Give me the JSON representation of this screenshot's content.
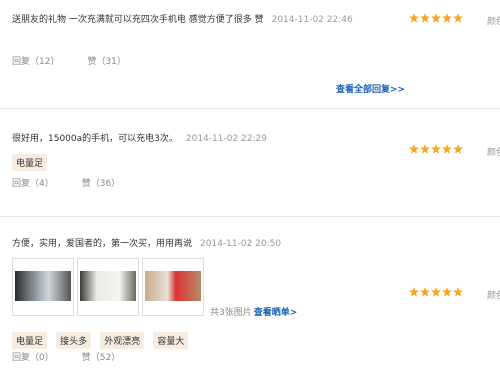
{
  "reviews": [
    {
      "text": "送朋友的礼物 一次充满就可以充四次手机电 感觉方便了很多 赞",
      "time": "2014-11-02 22:46",
      "rating": 5,
      "side": "颜色",
      "reply_label": "回复（12）",
      "like_label": "赞（31）",
      "view_all_replies": "查看全部回复>>"
    },
    {
      "text": "很好用，15000a的手机，可以充电3次。",
      "time": "2014-11-02 22:29",
      "rating": 5,
      "side": "颜色",
      "tags": [
        "电量足"
      ],
      "reply_label": "回复（4）",
      "like_label": "赞（36）"
    },
    {
      "text": "方便，实用，爱国者的，第一次买，用用再说",
      "time": "2014-11-02 20:50",
      "rating": 5,
      "side": "颜色",
      "tags": [
        "电量足",
        "接头多",
        "外观漂亮",
        "容量大"
      ],
      "image_count": "共3张图片",
      "view_order": "查看晒单>",
      "reply_label": "回复（0）",
      "like_label": "赞（52）"
    }
  ],
  "colors": {
    "star": "#f5a623",
    "link": "#1a5fb4",
    "tag_bg": "#f7ece0"
  },
  "icons": {
    "star": "star-icon"
  }
}
